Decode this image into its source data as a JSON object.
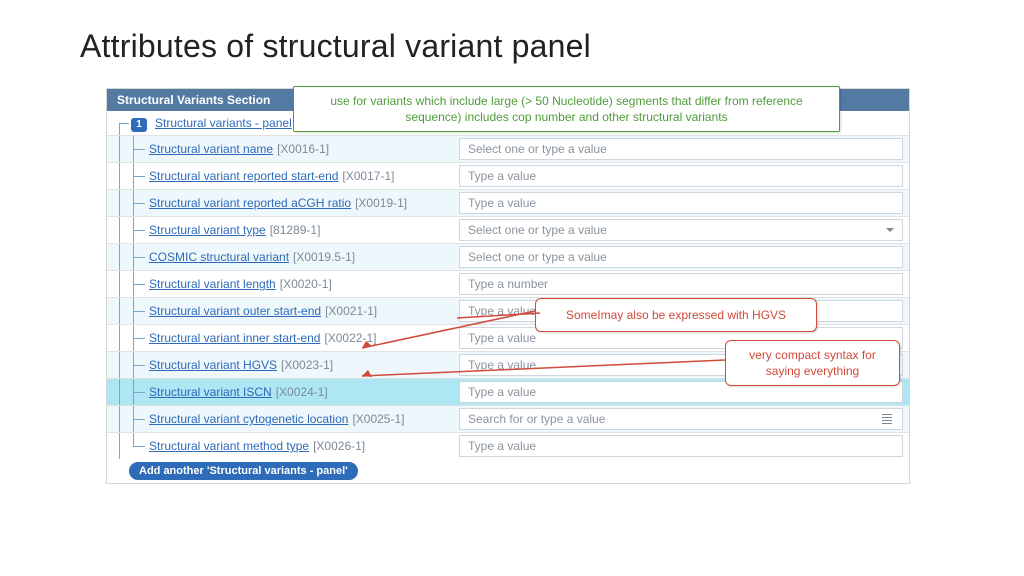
{
  "slide": {
    "title": "Attributes of structural variant panel"
  },
  "section": {
    "header": "Structural Variants Section"
  },
  "root_row": {
    "badge": "1",
    "label": "Structural variants - panel"
  },
  "rows": [
    {
      "label": "Structural variant name",
      "code": "[X0016-1]",
      "placeholder": "Select one or type a value",
      "kind": "plain",
      "bg": "bg-blue"
    },
    {
      "label": "Structural variant reported start-end",
      "code": "[X0017-1]",
      "placeholder": "Type a value",
      "kind": "plain",
      "bg": "bg-white"
    },
    {
      "label": "Structural variant reported aCGH ratio",
      "code": "[X0019-1]",
      "placeholder": "Type a value",
      "kind": "plain",
      "bg": "bg-blue"
    },
    {
      "label": "Structural variant type",
      "code": "[81289-1]",
      "placeholder": "Select one or type a value",
      "kind": "drop",
      "bg": "bg-white"
    },
    {
      "label": "COSMIC structural variant",
      "code": "[X0019.5-1]",
      "placeholder": "Select one or type a value",
      "kind": "plain",
      "bg": "bg-blue"
    },
    {
      "label": "Structural variant length",
      "code": "[X0020-1]",
      "placeholder": "Type a number",
      "kind": "plain",
      "bg": "bg-white"
    },
    {
      "label": "Structural variant outer start-end",
      "code": "[X0021-1]",
      "placeholder": "Type a value",
      "kind": "plain",
      "bg": "bg-blue"
    },
    {
      "label": "Structural variant inner start-end",
      "code": "[X0022-1]",
      "placeholder": "Type a value",
      "kind": "plain",
      "bg": "bg-white"
    },
    {
      "label": "Structural variant HGVS",
      "code": "[X0023-1]",
      "placeholder": "Type a value",
      "kind": "plain",
      "bg": "bg-blue"
    },
    {
      "label": "Structural variant ISCN",
      "code": "[X0024-1]",
      "placeholder": "Type a value",
      "kind": "plain",
      "bg": "highlight"
    },
    {
      "label": "Structural variant cytogenetic location",
      "code": "[X0025-1]",
      "placeholder": "Search for or type a value",
      "kind": "list",
      "bg": "bg-blue"
    },
    {
      "label": "Structural variant method type",
      "code": "[X0026-1]",
      "placeholder": "Type a value",
      "kind": "plain",
      "bg": "bg-white"
    }
  ],
  "add_button": {
    "label": "Add another 'Structural variants - panel'"
  },
  "callouts": {
    "green": "use for variants which include large (> 50 Nucleotide) segments that differ from reference sequence) includes cop number and other structural variants",
    "red1": "SomeImay also be expressed with HGVS",
    "red2": "very compact syntax for saying  everything"
  }
}
